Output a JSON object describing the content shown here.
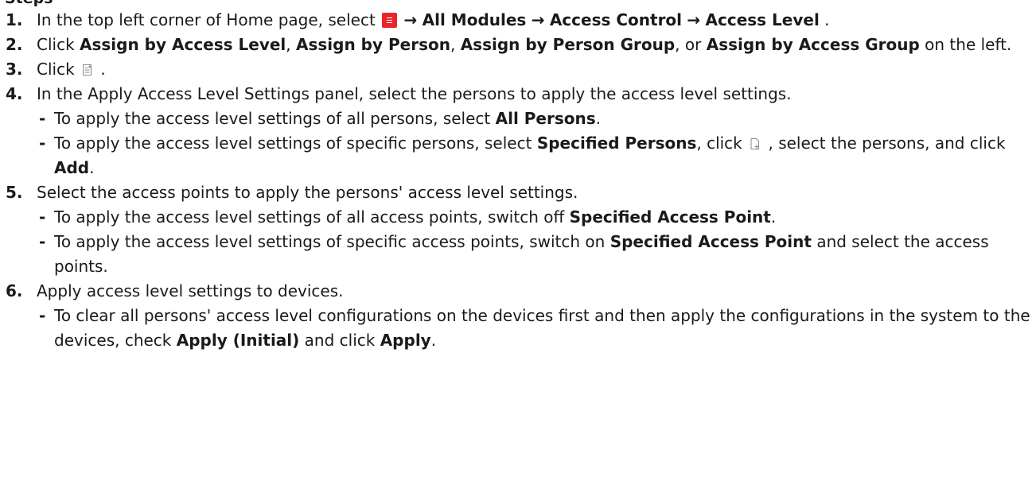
{
  "heading": "Steps",
  "arrow": "→",
  "steps": [
    {
      "num": "1.",
      "t1": "In the top left corner of Home page, select",
      "m1": "All Modules",
      "m2": "Access Control",
      "m3": "Access Level",
      "t2": "."
    },
    {
      "num": "2.",
      "t1": "Click",
      "b1": "Assign by Access Level",
      "t2": ",",
      "b2": "Assign by Person",
      "t3": ",",
      "b3": "Assign by Person Group",
      "t4": ", or",
      "b4": "Assign by Access Group",
      "t5": "on the left."
    },
    {
      "num": "3.",
      "t1": "Click",
      "t2": "."
    },
    {
      "num": "4.",
      "t1": "In the Apply Access Level Settings panel, select the persons to apply the access level settings.",
      "subs": [
        {
          "dash": "-",
          "t1": "To apply the access level settings of all persons, select",
          "b1": "All Persons",
          "t2": "."
        },
        {
          "dash": "-",
          "t1": "To apply the access level settings of specific persons, select",
          "b1": "Specified Persons",
          "t2": ", click",
          "t3": ", select the persons, and click",
          "b2": "Add",
          "t4": "."
        }
      ]
    },
    {
      "num": "5.",
      "t1": "Select the access points to apply the persons' access level settings.",
      "subs": [
        {
          "dash": "-",
          "t1": "To apply the access level settings of all access points, switch off",
          "b1": "Specified Access Point",
          "t2": "."
        },
        {
          "dash": "-",
          "t1": "To apply the access level settings of specific access points, switch on",
          "b1": "Specified Access Point",
          "t2": "and select the access points."
        }
      ]
    },
    {
      "num": "6.",
      "t1": "Apply access level settings to devices.",
      "subs": [
        {
          "dash": "-",
          "t1": "To clear all persons' access level configurations on the devices first and then apply the configurations in the system to the devices, check",
          "b1": "Apply (Initial)",
          "t2": "and click",
          "b2": "Apply",
          "t3": "."
        }
      ]
    }
  ],
  "icons": {
    "menu": "menu-icon",
    "apply_settings": "apply-settings-icon",
    "add_person": "add-person-icon"
  },
  "colors": {
    "menu_icon": "#e8252a",
    "text": "#1a1a1a"
  }
}
